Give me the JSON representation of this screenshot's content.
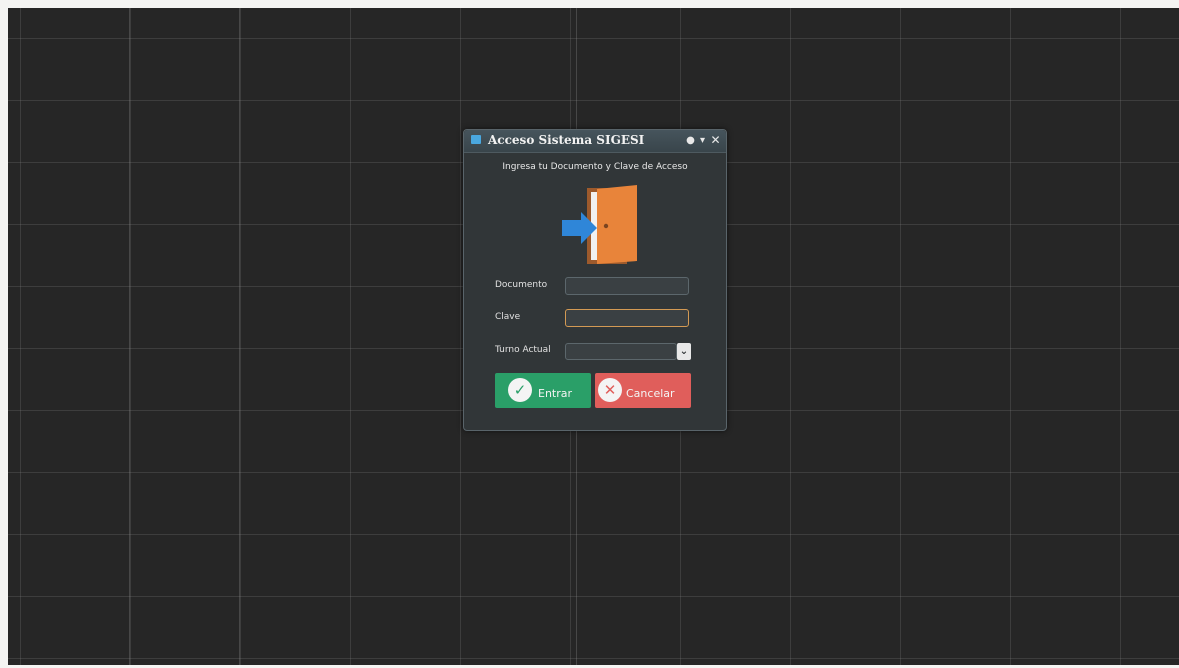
{
  "dialog": {
    "title": "Acceso Sistema SIGESI",
    "titlebar_buttons": [
      "pin",
      "maximize",
      "close"
    ],
    "subtitle": "Ingresa tu Documento y Clave de Acceso",
    "illustration": "door-enter-icon"
  },
  "form": {
    "documento_label": "Documento",
    "documento_value": "",
    "clave_label": "Clave",
    "clave_value": "",
    "turno_label": "Turno Actual",
    "turno_value": ""
  },
  "buttons": {
    "enter_label": "Entrar",
    "enter_icon": "check-circle-icon",
    "cancel_label": "Cancelar",
    "cancel_icon": "x-circle-icon"
  },
  "colors": {
    "background": "#262626",
    "dialog": "#313638",
    "enter_button": "#2a9f68",
    "cancel_button": "#e05e5b",
    "focus_border": "#d39a54",
    "door": "#e8843a",
    "arrow": "#2f86d8"
  }
}
